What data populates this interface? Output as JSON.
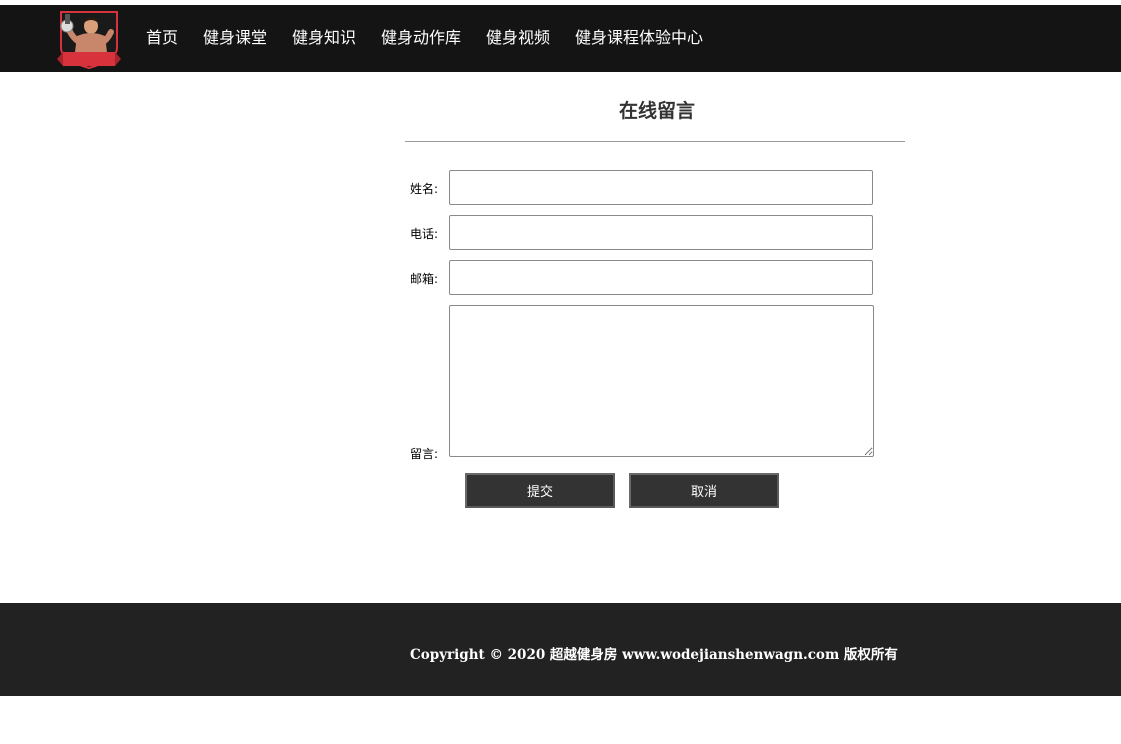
{
  "nav": {
    "items": [
      {
        "label": "首页"
      },
      {
        "label": "健身课堂"
      },
      {
        "label": "健身知识"
      },
      {
        "label": "健身动作库"
      },
      {
        "label": "健身视频"
      },
      {
        "label": "健身课程体验中心"
      }
    ]
  },
  "form": {
    "title": "在线留言",
    "name_label": "姓名:",
    "name_value": "",
    "phone_label": "电话:",
    "phone_value": "",
    "email_label": "邮箱:",
    "email_value": "",
    "message_label": "留言:",
    "message_value": "",
    "submit_label": "提交",
    "cancel_label": "取消"
  },
  "footer": {
    "copyright": "Copyright © 2020 超越健身房 www.wodejianshenwagn.com 版权所有"
  },
  "colors": {
    "header_bg": "#141414",
    "footer_bg": "#222222",
    "button_bg": "#333333",
    "logo_red": "#d8323c"
  },
  "icons": {
    "logo": "bodybuilder-logo-icon"
  }
}
